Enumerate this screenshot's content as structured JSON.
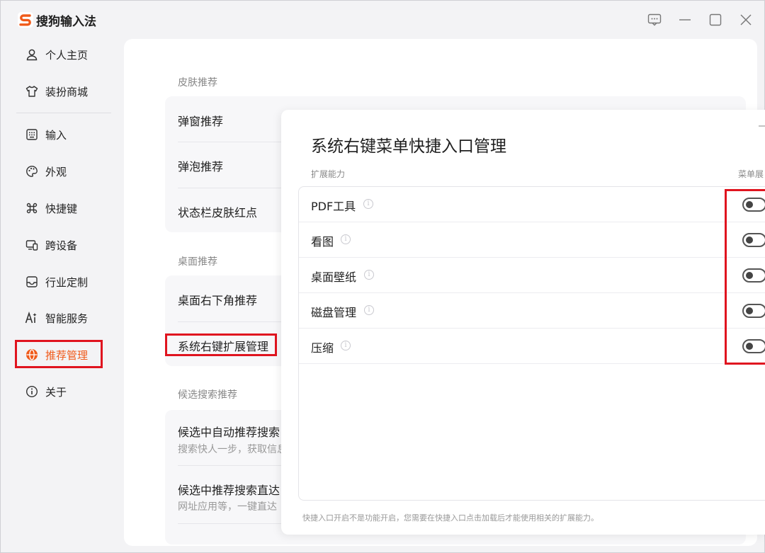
{
  "app": {
    "title": "搜狗输入法"
  },
  "sidebar": {
    "items": [
      {
        "label": "个人主页",
        "icon": "user-icon"
      },
      {
        "label": "装扮商城",
        "icon": "shirt-icon"
      },
      {
        "label": "输入",
        "icon": "keyboard-icon"
      },
      {
        "label": "外观",
        "icon": "palette-icon"
      },
      {
        "label": "快捷键",
        "icon": "command-icon"
      },
      {
        "label": "跨设备",
        "icon": "devices-icon"
      },
      {
        "label": "行业定制",
        "icon": "inbox-icon"
      },
      {
        "label": "智能服务",
        "icon": "ai-icon"
      },
      {
        "label": "推荐管理",
        "icon": "globe-icon",
        "active": true
      },
      {
        "label": "关于",
        "icon": "info-icon"
      }
    ]
  },
  "main": {
    "sections": [
      {
        "title": "皮肤推荐",
        "items": [
          "弹窗推荐",
          "弹泡推荐",
          "状态栏皮肤红点"
        ]
      },
      {
        "title": "桌面推荐",
        "items": [
          "桌面右下角推荐",
          "系统右键扩展管理"
        ]
      },
      {
        "title": "候选搜索推荐",
        "items": [
          {
            "label": "候选中自动推荐搜索",
            "sub": "搜索快人一步，获取信息"
          },
          {
            "label": "候选中推荐搜索直达",
            "sub": "网址应用等，一键直达"
          }
        ]
      }
    ]
  },
  "dialog": {
    "title": "系统右键菜单快捷入口管理",
    "col_left": "扩展能力",
    "col_right": "菜单展",
    "rows": [
      {
        "name": "PDF工具",
        "enabled": false
      },
      {
        "name": "看图",
        "enabled": false
      },
      {
        "name": "桌面壁纸",
        "enabled": false
      },
      {
        "name": "磁盘管理",
        "enabled": false
      },
      {
        "name": "压缩",
        "enabled": false
      }
    ],
    "footer": "快捷入口开启不是功能开启，您需要在快捷入口点击加载后才能使用相关的扩展能力。"
  },
  "colors": {
    "accent": "#f05a1a",
    "highlight_box": "#e0141f"
  }
}
